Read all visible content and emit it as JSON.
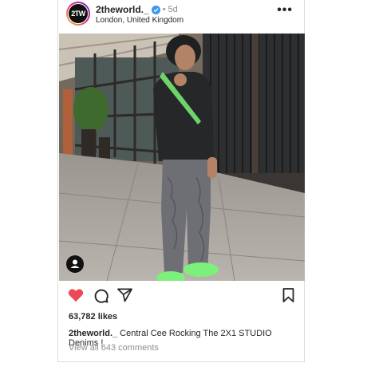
{
  "post": {
    "avatar_text": "2TW",
    "username": "2theworld._",
    "separator": "•",
    "time": "5d",
    "location": "London, United Kingdom",
    "likes": "63,782 likes",
    "caption_user": "2theworld._",
    "caption_text": " Central Cee Rocking The 2X1 STUDIO Denims !",
    "view_comments": "View all 643 comments",
    "liked": true
  },
  "icons": {
    "verified": "verified-badge-icon",
    "more": "more-options-icon",
    "like": "heart-icon",
    "comment": "comment-icon",
    "share": "paper-plane-icon",
    "save": "bookmark-icon",
    "user_tag": "user-tag-icon"
  },
  "colors": {
    "like_active": "#ed4956",
    "verified": "#3897f0",
    "secondary_text": "#8e8e8e",
    "border": "#dbdbdb",
    "shoes": "#7cf07a"
  }
}
